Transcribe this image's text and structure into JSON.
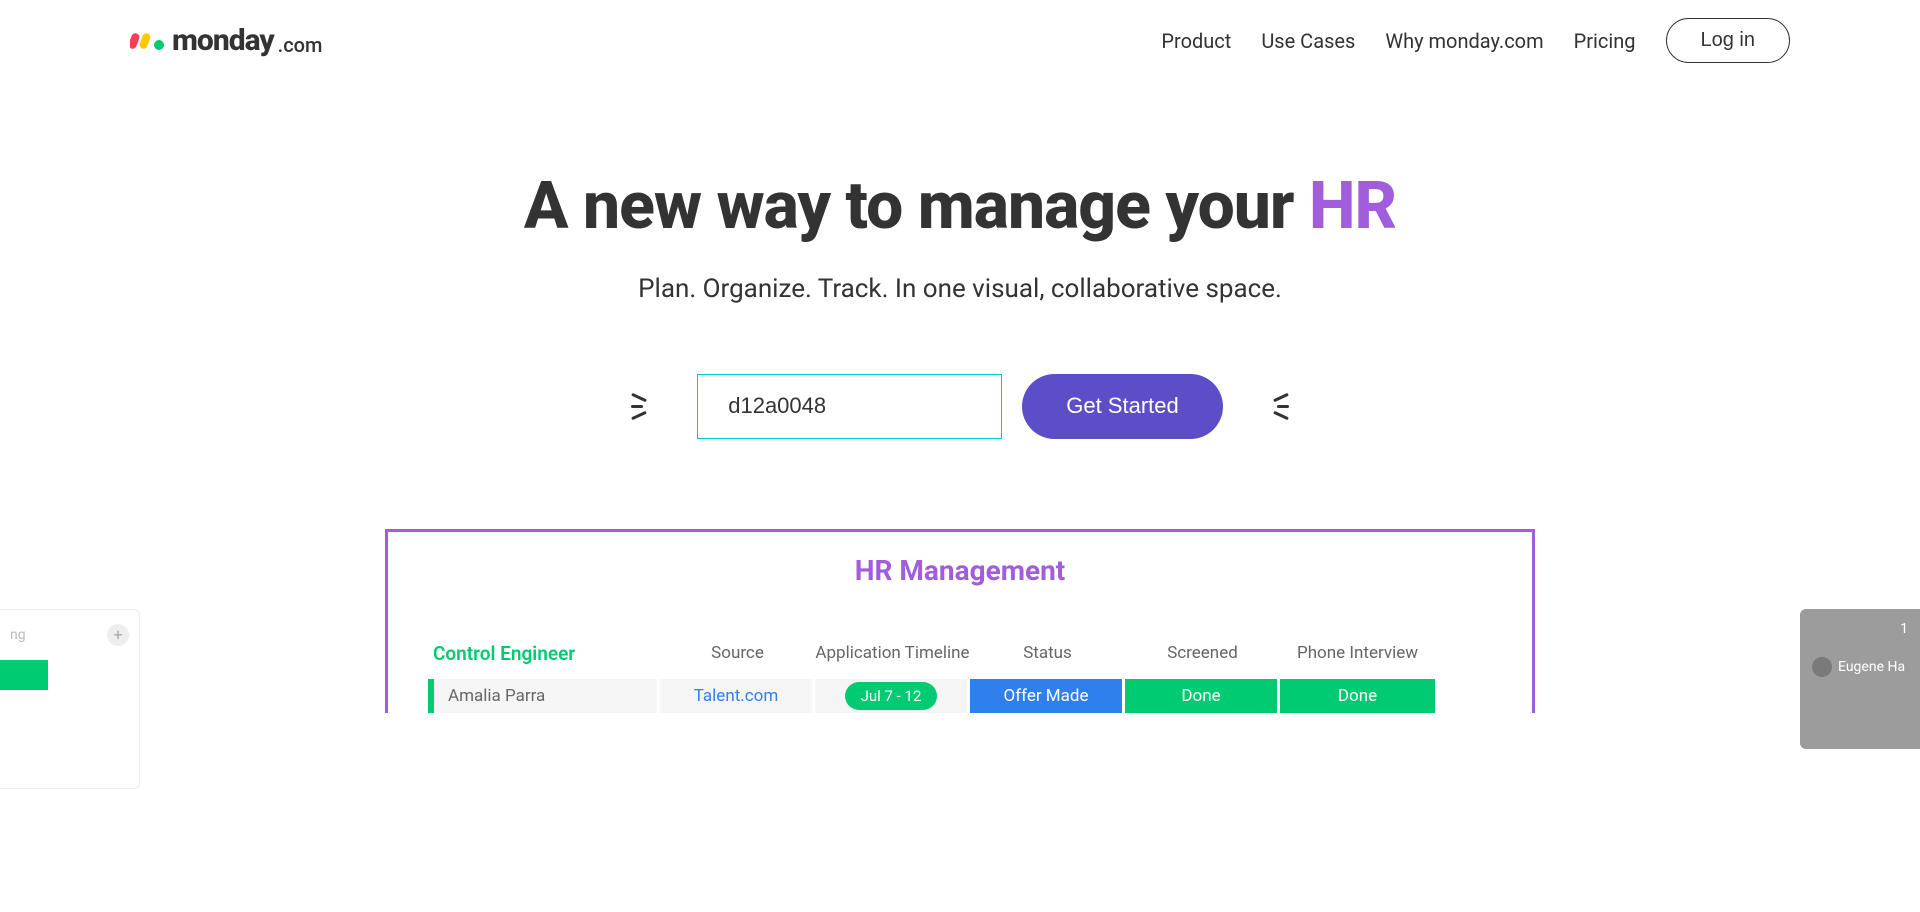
{
  "header": {
    "logo_text": "monday",
    "logo_suffix": ".com",
    "nav": {
      "product": "Product",
      "use_cases": "Use Cases",
      "why": "Why monday.com",
      "pricing": "Pricing"
    },
    "login": "Log in"
  },
  "hero": {
    "title_main": "A new way to manage your ",
    "title_accent": "HR",
    "subtitle": "Plan. Organize. Track. In one visual, collaborative space.",
    "email_value": "d12a0048",
    "cta": "Get Started"
  },
  "board": {
    "title": "HR Management",
    "group_label": "Control Engineer",
    "columns": {
      "source": "Source",
      "timeline": "Application Timeline",
      "status": "Status",
      "screened": "Screened",
      "phone": "Phone Interview"
    },
    "row1": {
      "name": "Amalia Parra",
      "source": "Talent.com",
      "timeline": "Jul 7 - 12",
      "status": "Offer Made",
      "screened": "Done",
      "phone": "Done"
    },
    "left_peek_label": "ng",
    "right_peek_badge": "1",
    "right_peek_name": "Eugene Ha"
  },
  "colors": {
    "purple": "#a25ddc",
    "green": "#00ca72",
    "blue": "#2f80ed",
    "indigo": "#5b4ec7",
    "teal": "#00c9c9"
  }
}
